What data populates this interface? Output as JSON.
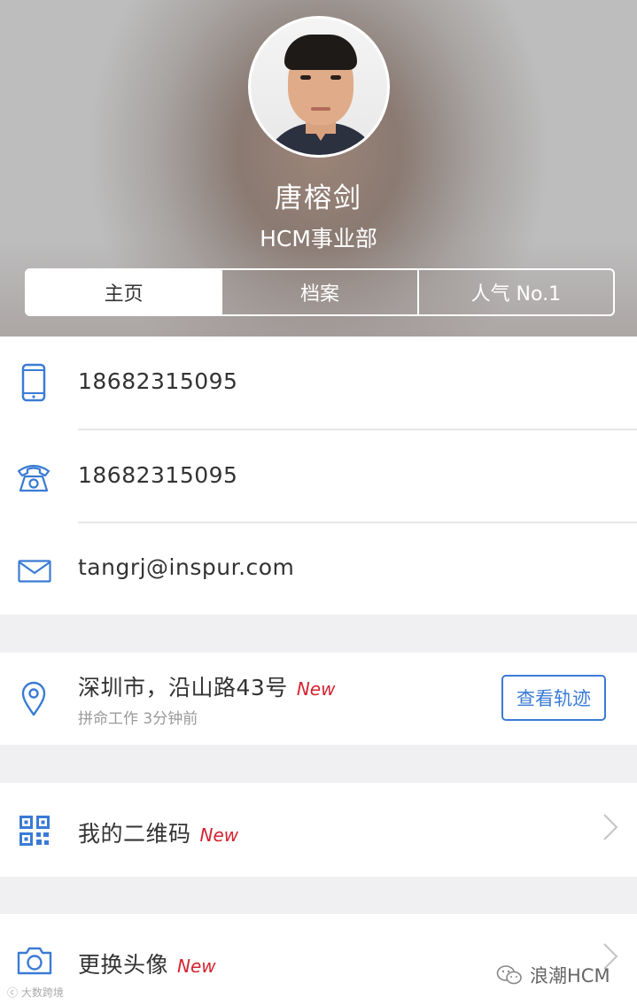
{
  "profile": {
    "name": "唐榕剑",
    "department": "HCM事业部"
  },
  "tabs": [
    {
      "label": "主页",
      "active": true
    },
    {
      "label": "档案",
      "active": false
    },
    {
      "label": "人气 No.1",
      "active": false
    }
  ],
  "contact": {
    "mobile": "18682315095",
    "phone": "18682315095",
    "email": "tangrj@inspur.com"
  },
  "location": {
    "address": "深圳市，沿山路43号",
    "badge": "New",
    "status": "拼命工作 3分钟前",
    "button_label": "查看轨迹"
  },
  "menu": [
    {
      "label": "我的二维码",
      "badge": "New"
    },
    {
      "label": "更换头像",
      "badge": "New"
    }
  ],
  "watermarks": {
    "left": "大数跨境",
    "right": "浪潮HCM"
  },
  "colors": {
    "accent": "#3a7bd5",
    "badge_red": "#d42330",
    "background": "#f0f0f2"
  },
  "icons": {
    "mobile": "mobile-phone-icon",
    "phone": "telephone-icon",
    "email": "mail-icon",
    "location": "location-pin-icon",
    "qr": "qr-code-icon",
    "camera": "camera-icon"
  }
}
